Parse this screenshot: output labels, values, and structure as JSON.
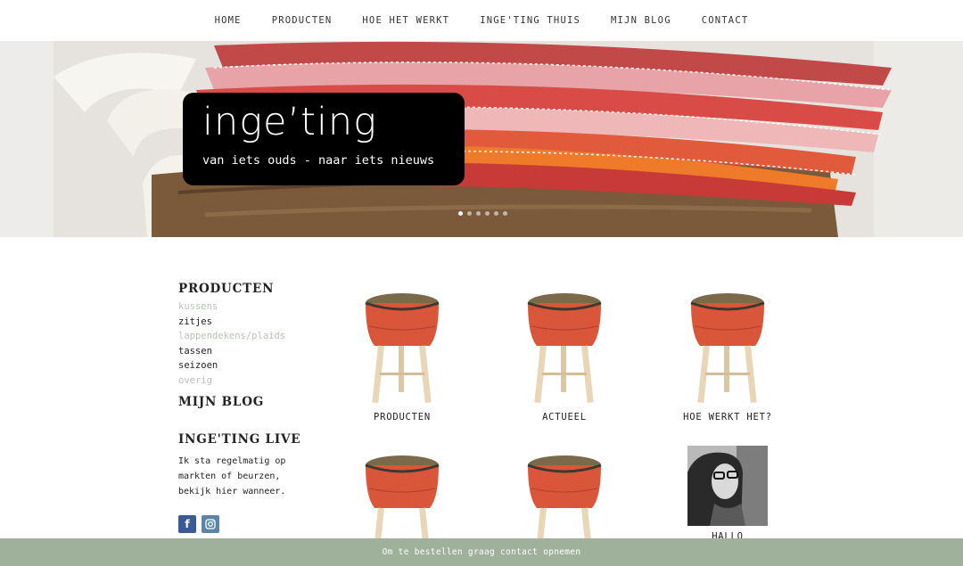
{
  "nav": {
    "items": [
      "HOME",
      "PRODUCTEN",
      "HOE HET WERKT",
      "INGE'TING THUIS",
      "MIJN BLOG",
      "CONTACT"
    ]
  },
  "hero": {
    "logo_title": "inge’ting",
    "logo_tagline": "van iets ouds - naar iets nieuws",
    "slide_count": 6,
    "active_slide": 1
  },
  "sidebar": {
    "products_heading": "PRODUCTEN",
    "product_links": [
      {
        "label": "kussens",
        "style": "muted"
      },
      {
        "label": "zitjes",
        "style": "dark"
      },
      {
        "label": "lappendekens/plaids",
        "style": "muted"
      },
      {
        "label": "tassen",
        "style": "dark"
      },
      {
        "label": "seizoen",
        "style": "dark"
      },
      {
        "label": "overig",
        "style": "muted"
      }
    ],
    "blog_heading": "MIJN BLOG",
    "live_heading": "INGE'TING LIVE",
    "live_text": "Ik sta regelmatig op markten of beurzen, bekijk hier wanneer.",
    "social": [
      "facebook-icon",
      "instagram-icon"
    ]
  },
  "grid": {
    "tiles": [
      {
        "label": "PRODUCTEN",
        "image": "stool"
      },
      {
        "label": "ACTUEEL",
        "image": "stool"
      },
      {
        "label": "HOE WERKT HET?",
        "image": "stool"
      },
      {
        "label": "",
        "image": "stool"
      },
      {
        "label": "",
        "image": "stool"
      },
      {
        "label": "HALLO",
        "image": "portrait"
      }
    ]
  },
  "footer_bar": {
    "text": "Om te bestellen graag contact opnemen"
  },
  "colors": {
    "accent_green": "#9fb09b",
    "muted_link": "#b8c3b6",
    "stool_red": "#d9563a",
    "facebook": "#3b5a98",
    "instagram": "#5b85a8"
  }
}
